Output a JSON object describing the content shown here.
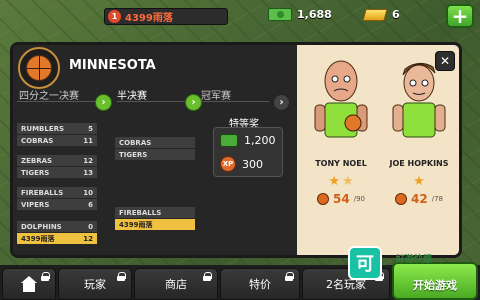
{
  "topbar": {
    "level": "1",
    "player_name": "4399雨落",
    "cash": "1,688",
    "gold": "6",
    "add_label": "+"
  },
  "panel": {
    "team_title": "MINNESOTA",
    "close_label": "✕",
    "rounds": {
      "quarter": "四分之一决赛",
      "semi": "半决赛",
      "final": "冠军赛"
    },
    "quarter_matches": [
      {
        "a": {
          "name": "RUMBLERS",
          "score": "5"
        },
        "b": {
          "name": "COBRAS",
          "score": "11"
        }
      },
      {
        "a": {
          "name": "ZEBRAS",
          "score": "12"
        },
        "b": {
          "name": "TIGERS",
          "score": "13"
        }
      },
      {
        "a": {
          "name": "FIREBALLS",
          "score": "10"
        },
        "b": {
          "name": "VIPERS",
          "score": "6"
        }
      },
      {
        "a": {
          "name": "DOLPHINS",
          "score": "0"
        },
        "b": {
          "name": "4399雨落",
          "score": "12"
        }
      }
    ],
    "semi_matches": [
      {
        "a": "COBRAS",
        "b": "TIGERS"
      },
      {
        "a": "FIREBALLS",
        "b": "4399雨落"
      }
    ],
    "prize": {
      "label": "特等奖",
      "cash": "1,200",
      "xp_label": "XP",
      "xp": "300"
    },
    "players": [
      {
        "name": "TONY NOEL",
        "value": "54",
        "max": "/90",
        "stars_full": 1,
        "stars_half": 1
      },
      {
        "name": "JOE HOPKINS",
        "value": "42",
        "max": "/78",
        "stars_full": 1,
        "stars_half": 0
      }
    ]
  },
  "bottom": {
    "tabs": [
      "玩家",
      "商店",
      "特价",
      "2名玩家"
    ],
    "start_label": "开始游戏",
    "watermark_glyph": "可",
    "watermark_text": "好游快爆"
  },
  "colors": {
    "accent_green": "#6abf2c",
    "highlight_yellow": "#f0c040",
    "name_orange": "#ff6a3c"
  }
}
